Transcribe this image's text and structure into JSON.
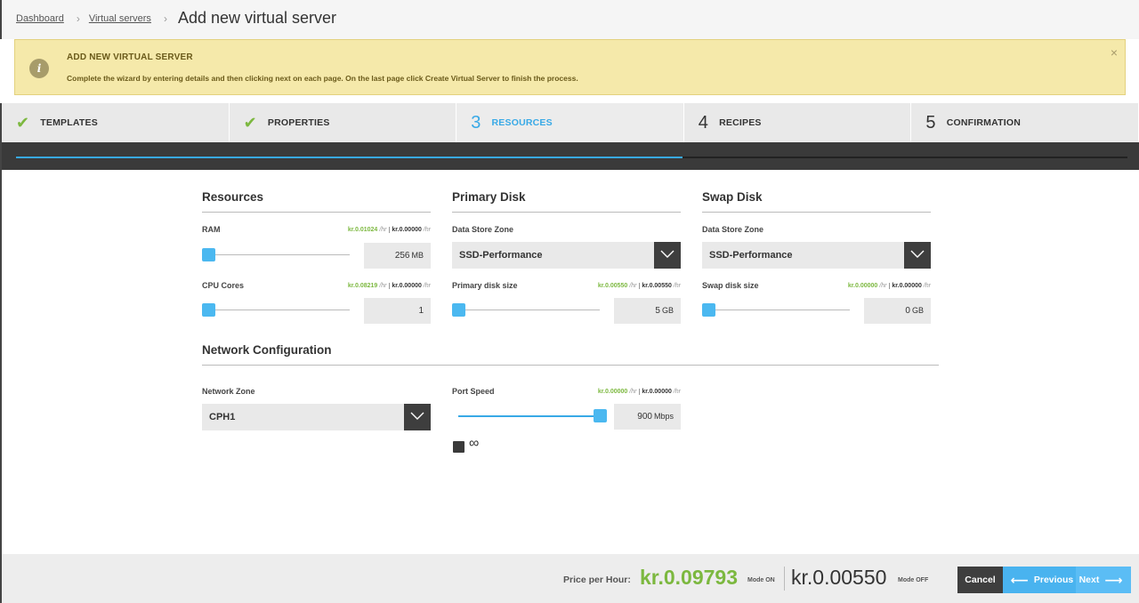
{
  "breadcrumb": {
    "items": [
      "Dashboard",
      "Virtual servers"
    ],
    "title": "Add new virtual server"
  },
  "banner": {
    "title": "ADD NEW VIRTUAL SERVER",
    "text": "Complete the wizard by entering details and then clicking next on each page. On the last page click Create Virtual Server to finish the process.",
    "close": "×",
    "icon": "i"
  },
  "steps": [
    {
      "label": "TEMPLATES",
      "state": "done",
      "mark": "✔"
    },
    {
      "label": "PROPERTIES",
      "state": "done",
      "mark": "✔"
    },
    {
      "label": "RESOURCES",
      "state": "active",
      "mark": "3"
    },
    {
      "label": "RECIPES",
      "state": "pending",
      "mark": "4"
    },
    {
      "label": "CONFIRMATION",
      "state": "pending",
      "mark": "5"
    }
  ],
  "progress": {
    "fraction": 0.6
  },
  "resources": {
    "title": "Resources",
    "ram": {
      "label": "RAM",
      "price_on": "kr.0.01024",
      "price_off": "kr.0.00000",
      "unit": "/hr",
      "value": "256",
      "value_unit": "MB",
      "level": 0.0
    },
    "cpu": {
      "label": "CPU Cores",
      "price_on": "kr.0.08219",
      "price_off": "kr.0.00000",
      "unit": "/hr",
      "value": "1",
      "value_unit": "",
      "level": 0.0
    }
  },
  "primary_disk": {
    "title": "Primary Disk",
    "zone_label": "Data Store Zone",
    "zone_value": "SSD-Performance",
    "size_label": "Primary disk size",
    "price_on": "kr.0.00550",
    "price_off": "kr.0.00550",
    "unit": "/hr",
    "value": "5",
    "value_unit": "GB",
    "level": 0.0
  },
  "swap_disk": {
    "title": "Swap Disk",
    "zone_label": "Data Store Zone",
    "zone_value": "SSD-Performance",
    "size_label": "Swap disk size",
    "price_on": "kr.0.00000",
    "price_off": "kr.0.00000",
    "unit": "/hr",
    "value": "0",
    "value_unit": "GB",
    "level": 0.0
  },
  "network": {
    "title": "Network Configuration",
    "zone_label": "Network Zone",
    "zone_value": "CPH1",
    "port_label": "Port Speed",
    "price_on": "kr.0.00000",
    "price_off": "kr.0.00000",
    "unit": "/hr",
    "value": "900",
    "value_unit": "Mbps",
    "level": 1.0,
    "unlimited_symbol": "∞"
  },
  "footer": {
    "price_label": "Price per Hour:",
    "price_on": "kr.0.09793",
    "mode_on": "Mode ON",
    "price_off": "kr.0.00550",
    "mode_off": "Mode OFF",
    "cancel": "Cancel",
    "previous": "Previous",
    "next": "Next"
  },
  "colors": {
    "accent": "#38a9e6",
    "green": "#7cb83f",
    "dark": "#3e3e3e",
    "banner": "#f5e9aa"
  }
}
